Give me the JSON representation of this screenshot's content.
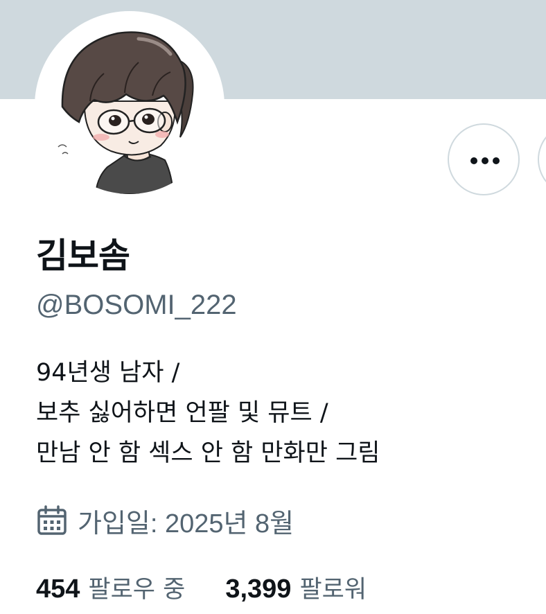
{
  "profile": {
    "display_name": "김보솜",
    "handle": "@BOSOMI_222",
    "bio_lines": [
      "94년생 남자 /",
      "보추 싫어하면 언팔 및 뮤트 /",
      "만남 안 함 섹스 안 함 만화만 그림"
    ],
    "joined": "가입일: 2025년 8월"
  },
  "stats": {
    "following_count": "454",
    "following_label": "팔로우 중",
    "followers_count": "3,399",
    "followers_label": "팔로워"
  },
  "icons": {
    "more": "more-horizontal-icon",
    "calendar": "calendar-icon"
  },
  "colors": {
    "banner": "#cfd9de",
    "text_primary": "#0f1419",
    "text_secondary": "#536471",
    "border": "#cfd9de"
  }
}
